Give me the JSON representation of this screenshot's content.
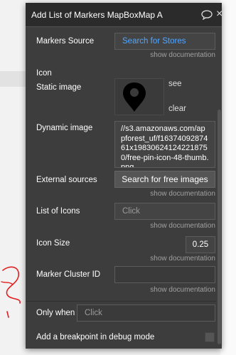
{
  "panel": {
    "title": "Add List of Markers MapBoxMap A"
  },
  "fields": {
    "markers_source": {
      "label": "Markers Source",
      "value": "Search for Stores",
      "doc": "show documentation"
    },
    "icon": {
      "label": "Icon"
    },
    "static_image": {
      "label": "Static image",
      "see": "see",
      "clear": "clear"
    },
    "dynamic_image": {
      "label": "Dynamic image",
      "value": "//s3.amazonaws.com/appforest_uf/f1637409287461x198306241242218750/free-pin-icon-48-thumb.png"
    },
    "external_sources": {
      "label": "External sources",
      "button": "Search for free images",
      "doc": "show documentation"
    },
    "list_of_icons": {
      "label": "List of Icons",
      "placeholder": "Click",
      "doc": "show documentation"
    },
    "icon_size": {
      "label": "Icon Size",
      "value": "0.25",
      "doc": "show documentation"
    },
    "marker_cluster_id": {
      "label": "Marker Cluster ID",
      "value": "",
      "doc": "show documentation"
    },
    "only_when": {
      "label": "Only when",
      "placeholder": "Click"
    },
    "breakpoint": {
      "label": "Add a breakpoint in debug mode",
      "checked": false
    }
  },
  "icons": {
    "static_preview": "map-pin-icon",
    "chat": "chat-bubble-icon",
    "close": "close-icon"
  },
  "colors": {
    "panel_bg": "#3d3d3d",
    "titlebar_bg": "#2b2b2b",
    "link": "#52a6ff",
    "annotation": "#e02020"
  }
}
